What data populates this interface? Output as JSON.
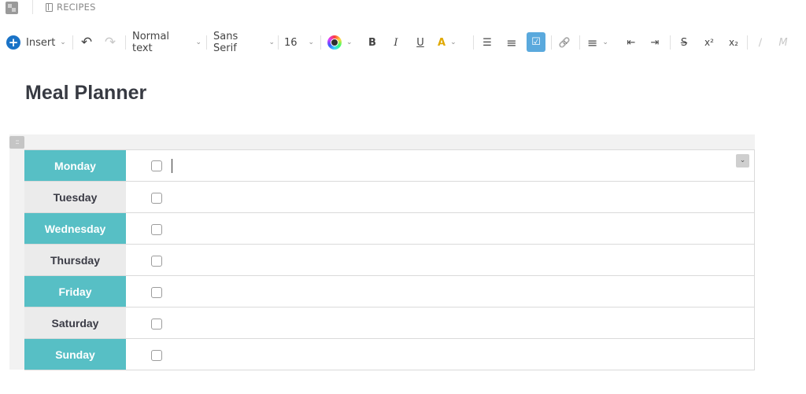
{
  "topbar": {
    "app_icon": "resize-icon",
    "breadcrumb_icon": "page-icon",
    "breadcrumb": "RECIPES"
  },
  "toolbar": {
    "insert_label": "Insert",
    "insert_icon": "plus-circle-icon",
    "undo_icon": "↶",
    "redo_icon": "↷",
    "paragraph_style": "Normal text",
    "font_family": "Sans Serif",
    "font_size": "16",
    "chevron": "⌄",
    "bold": "B",
    "italic": "I",
    "underline": "U",
    "highlight": "A",
    "bullet_list": "☰",
    "numbered_list": "≡",
    "checklist": "☑",
    "link": "🔗",
    "align": "≡",
    "indent_decrease": "⇤",
    "indent_increase": "⇥",
    "strikethrough": "S",
    "superscript": "x²",
    "subscript": "x₂",
    "clear_format": "∕",
    "format_painter": "M",
    "accent_color": "#1a73c7",
    "active_color": "#5aa9dd"
  },
  "document": {
    "title": "Meal Planner"
  },
  "table": {
    "drag_handle": "::",
    "cell_menu_icon": "⌄",
    "rows": [
      {
        "day": "Monday",
        "style": "teal",
        "checked": false,
        "text": ""
      },
      {
        "day": "Tuesday",
        "style": "grey",
        "checked": false,
        "text": ""
      },
      {
        "day": "Wednesday",
        "style": "teal",
        "checked": false,
        "text": ""
      },
      {
        "day": "Thursday",
        "style": "grey",
        "checked": false,
        "text": ""
      },
      {
        "day": "Friday",
        "style": "teal",
        "checked": false,
        "text": ""
      },
      {
        "day": "Saturday",
        "style": "grey",
        "checked": false,
        "text": ""
      },
      {
        "day": "Sunday",
        "style": "teal",
        "checked": false,
        "text": ""
      }
    ],
    "colors": {
      "teal": "#57bfc5",
      "grey": "#ebebeb"
    }
  }
}
